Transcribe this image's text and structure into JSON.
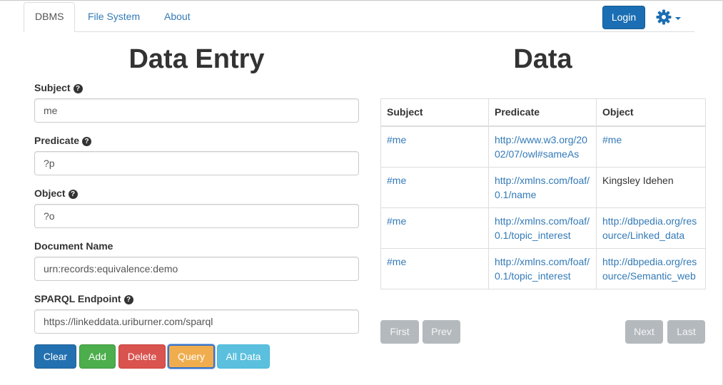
{
  "nav": {
    "tabs": [
      {
        "label": "DBMS",
        "active": true
      },
      {
        "label": "File System",
        "active": false
      },
      {
        "label": "About",
        "active": false
      }
    ],
    "login_label": "Login",
    "settings_icon": "gear-icon"
  },
  "entry": {
    "title": "Data Entry",
    "fields": {
      "subject": {
        "label": "Subject",
        "value": "me",
        "help_icon": "question-circle-icon"
      },
      "predicate": {
        "label": "Predicate",
        "value": "?p",
        "help_icon": "question-circle-icon"
      },
      "object": {
        "label": "Object",
        "value": "?o",
        "help_icon": "question-circle-icon"
      },
      "document": {
        "label": "Document Name",
        "value": "urn:records:equivalence:demo"
      },
      "endpoint": {
        "label": "SPARQL Endpoint",
        "value": "https://linkeddata.uriburner.com/sparql",
        "help_icon": "question-circle-icon"
      }
    },
    "buttons": {
      "clear": "Clear",
      "add": "Add",
      "delete": "Delete",
      "query": "Query",
      "all_data": "All Data"
    }
  },
  "data": {
    "title": "Data",
    "columns": [
      "Subject",
      "Predicate",
      "Object"
    ],
    "rows": [
      [
        "#me",
        "http://www.w3.org/2002/07/owl#sameAs",
        "#me"
      ],
      [
        "#me",
        "http://xmlns.com/foaf/0.1/name",
        "Kingsley Idehen"
      ],
      [
        "#me",
        "http://xmlns.com/foaf/0.1/topic_interest",
        "http://dbpedia.org/resource/Linked_data"
      ],
      [
        "#me",
        "http://xmlns.com/foaf/0.1/topic_interest",
        "http://dbpedia.org/resource/Semantic_web"
      ]
    ],
    "pager": {
      "first": "First",
      "prev": "Prev",
      "next": "Next",
      "last": "Last"
    }
  },
  "colors": {
    "primary": "#2370b0",
    "success": "#4cae4c",
    "danger": "#d9534f",
    "warning": "#f0ad4e",
    "info": "#5bc0de",
    "link": "#337ab7",
    "pager_disabled": "#b4b9bd"
  }
}
